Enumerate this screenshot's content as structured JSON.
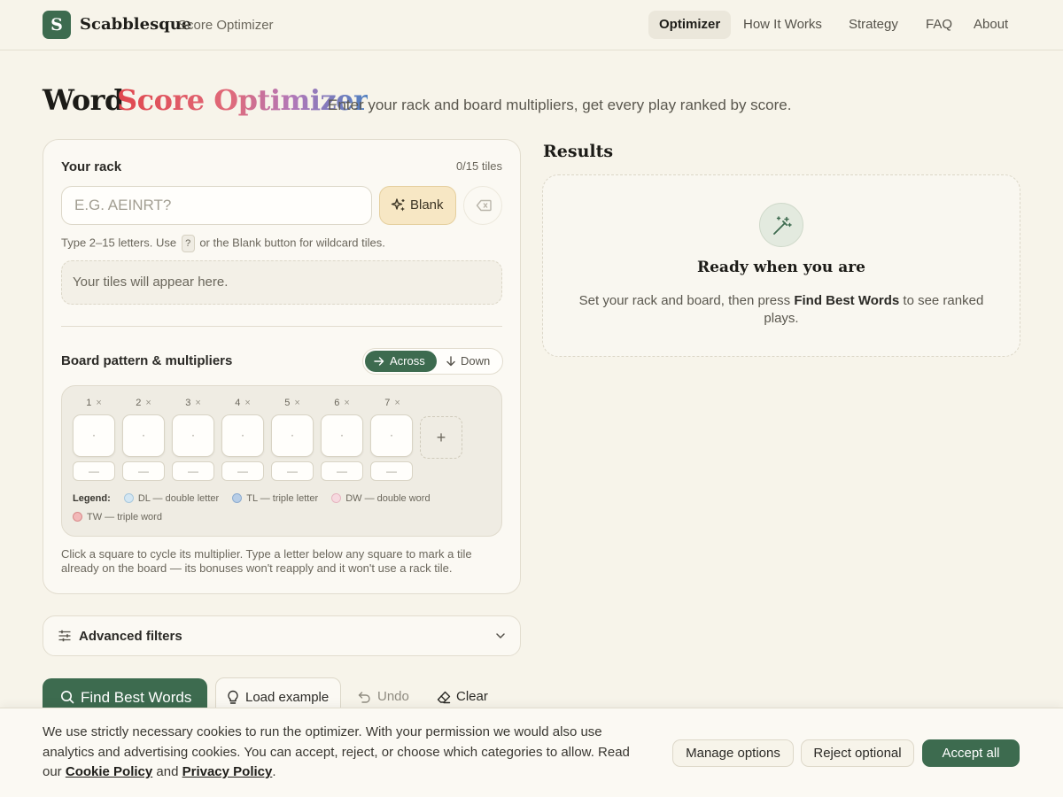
{
  "header": {
    "logo_letter": "S",
    "brand": "Scabblesque",
    "brand_sub": "Score Optimizer",
    "nav": [
      {
        "label": "Optimizer",
        "active": true
      },
      {
        "label": "How It Works",
        "active": false
      },
      {
        "label": "Strategy",
        "active": false
      },
      {
        "label": "FAQ",
        "active": false
      },
      {
        "label": "About",
        "active": false
      }
    ]
  },
  "hero": {
    "title_plain": "Word",
    "title_gradient": "Score Optimizer",
    "description": "Enter your rack and board multipliers, get every play ranked by score."
  },
  "rack": {
    "label": "Your rack",
    "count": "0/15 tiles",
    "placeholder": "E.G. AEINRT?",
    "blank_label": "Blank",
    "hint_before": "Type 2–15 letters. Use",
    "hint_key": "?",
    "hint_after": "or the Blank button for wildcard tiles.",
    "tiles_placeholder": "Your tiles will appear here."
  },
  "board": {
    "label": "Board pattern & multipliers",
    "direction_across": "Across",
    "direction_down": "Down",
    "columns": [
      "1",
      "2",
      "3",
      "4",
      "5",
      "6",
      "7"
    ],
    "remove_glyph": "×",
    "square_glyph": "·",
    "letter_placeholder": "—",
    "add_glyph": "+",
    "legend_label": "Legend:",
    "legend": [
      {
        "text": "DL — double letter",
        "fill": "#d3e6f2",
        "stroke": "#a9c9de"
      },
      {
        "text": "TL — triple letter",
        "fill": "#b7cde6",
        "stroke": "#8eadd0"
      },
      {
        "text": "DW — double word",
        "fill": "#f6d9df",
        "stroke": "#e6b5c0"
      },
      {
        "text": "TW — triple word",
        "fill": "#f2b8b8",
        "stroke": "#d98a8a"
      }
    ],
    "help": "Click a square to cycle its multiplier. Type a letter below any square to mark a tile already on the board — its bonuses won't reapply and it won't use a rack tile."
  },
  "filters": {
    "label": "Advanced filters"
  },
  "actions": {
    "find": "Find Best Words",
    "example": "Load example",
    "undo": "Undo",
    "clear": "Clear"
  },
  "results": {
    "title": "Results",
    "empty_heading": "Ready when you are",
    "empty_before": "Set your rack and board, then press",
    "empty_strong": "Find Best Words",
    "empty_after": "to see ranked plays."
  },
  "cookie": {
    "text": "We use strictly necessary cookies to run the optimizer. With your permission we would also use analytics and advertising cookies. You can accept, reject, or choose which categories to allow. Read our",
    "cookie_link": "Cookie Policy",
    "and": "and",
    "privacy_link": "Privacy Policy",
    "end": ".",
    "manage": "Manage options",
    "reject": "Reject optional",
    "accept": "Accept all"
  },
  "colors": {
    "accent": "#3d6b4f",
    "background": "#f7f4ea",
    "blank_button": "#f7e7c4"
  }
}
